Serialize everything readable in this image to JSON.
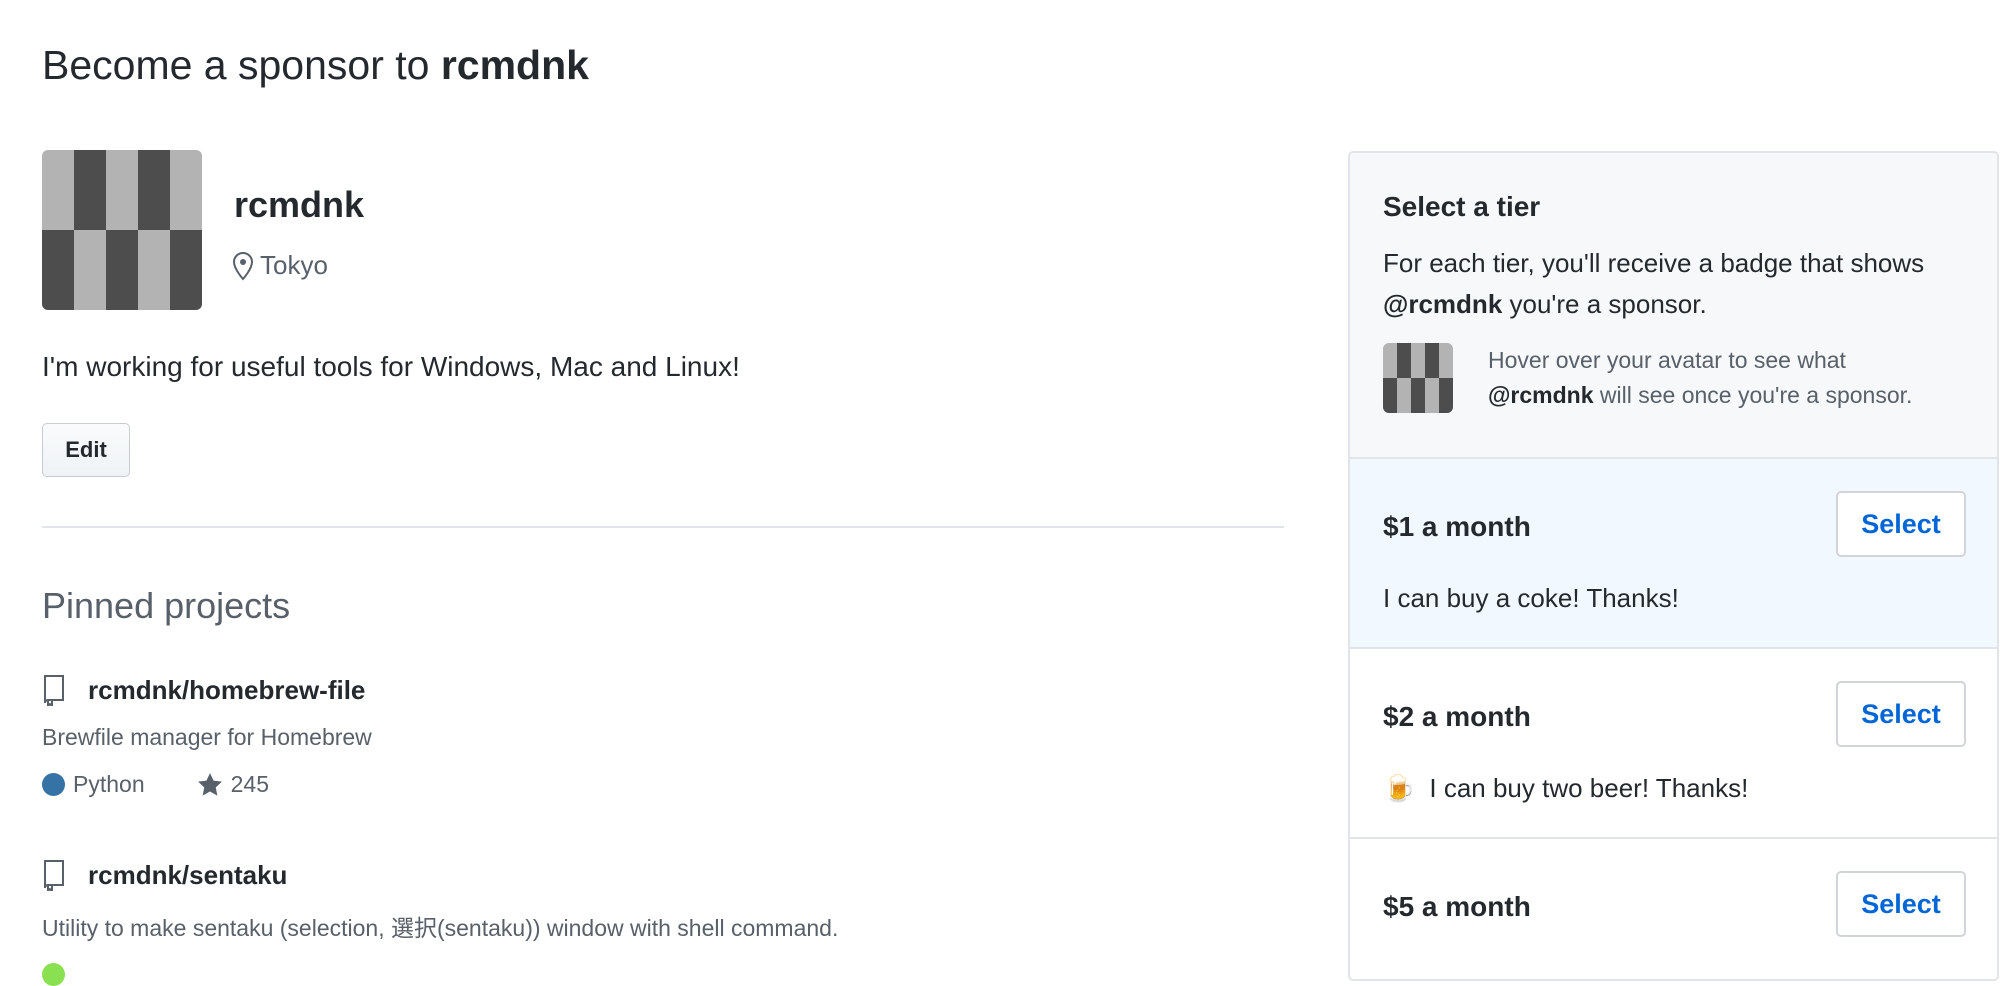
{
  "page": {
    "title_prefix": "Become a sponsor to ",
    "title_user": "rcmdnk"
  },
  "profile": {
    "name": "rcmdnk",
    "location": "Tokyo",
    "location_icon": "location-pin-icon",
    "bio": "I'm working for useful tools for Windows, Mac and Linux!",
    "edit_label": "Edit"
  },
  "pinned": {
    "heading": "Pinned projects",
    "repos": [
      {
        "name": "rcmdnk/homebrew-file",
        "description": "Brewfile manager for Homebrew",
        "language": "Python",
        "language_color": "#3572A5",
        "stars": "245"
      },
      {
        "name": "rcmdnk/sentaku",
        "description": "Utility to make sentaku (selection, 選択(sentaku)) window with shell command."
      }
    ]
  },
  "tiers": {
    "heading": "Select a tier",
    "intro_text": "For each tier, you'll receive a badge that shows ",
    "intro_user": "@rcmdnk",
    "intro_suffix": " you're a sponsor.",
    "hover_text_1": "Hover over your avatar to see what",
    "hover_user": "@rcmdnk",
    "hover_text_2": " will see once you're a sponsor.",
    "items": [
      {
        "price": "$1 a month",
        "description": "I can buy a coke! Thanks!",
        "select_label": "Select",
        "highlighted": true
      },
      {
        "price": "$2 a month",
        "emoji": "🍺",
        "description": "I can buy two beer! Thanks!",
        "select_label": "Select"
      },
      {
        "price": "$5 a month",
        "select_label": "Select"
      }
    ]
  },
  "colors": {
    "link": "#0366d6",
    "highlight_bg": "#f1f8ff",
    "panel_bg": "#f6f8fa"
  }
}
